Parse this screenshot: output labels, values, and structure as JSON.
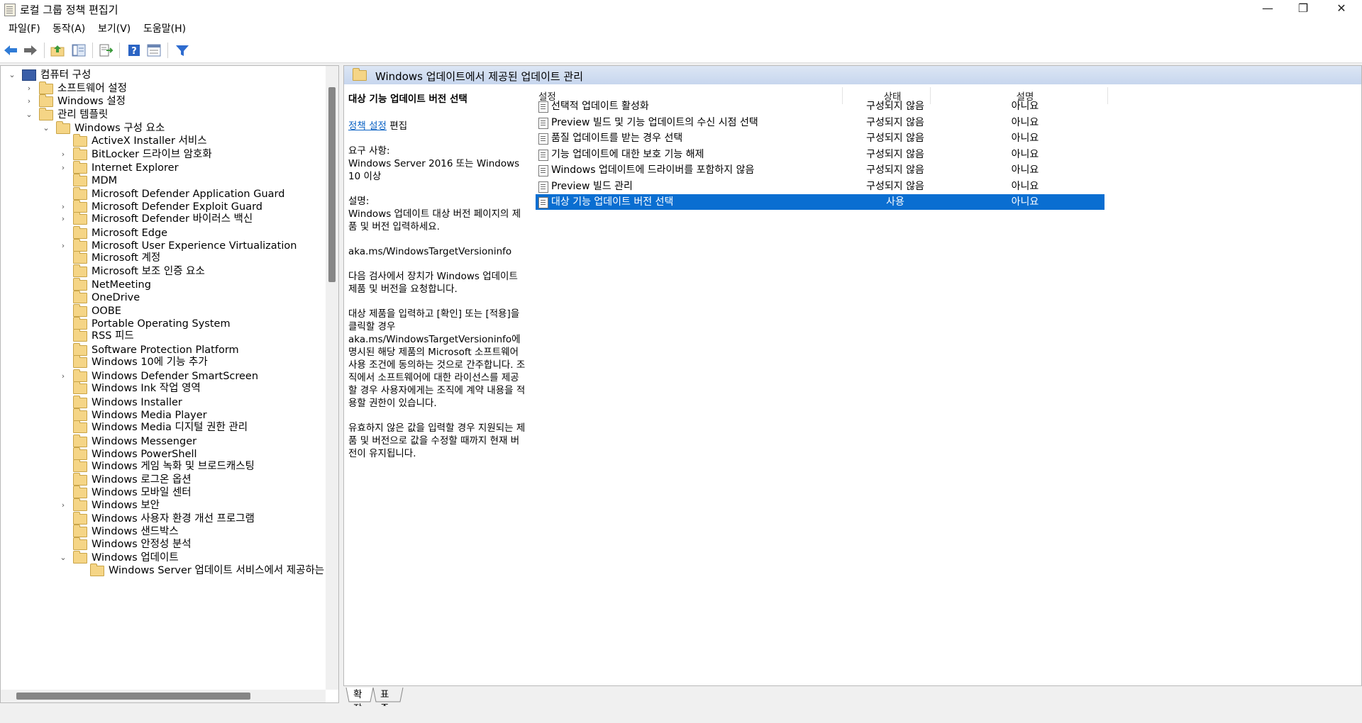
{
  "window": {
    "title": "로컬 그룹 정책 편집기",
    "minimize": "—",
    "restore": "❐",
    "close": "✕"
  },
  "menu": [
    "파일(F)",
    "동작(A)",
    "보기(V)",
    "도움말(H)"
  ],
  "toolbar": {
    "icons": [
      "back-arrow-icon",
      "forward-arrow-icon",
      "up-folder-icon",
      "show-hide-tree-icon",
      "export-list-icon",
      "help-icon",
      "properties-icon",
      "filter-icon"
    ],
    "colors": {
      "back": "#2f7bd6",
      "forward": "#6a6a6a",
      "help": "#2b64c4",
      "filter": "#2d6bcf"
    }
  },
  "tree": [
    {
      "label": "컴퓨터 구성",
      "exp": "⌄",
      "icon": "computer"
    },
    {
      "label": "소프트웨어 설정",
      "exp": "›"
    },
    {
      "label": "Windows 설정",
      "exp": "›"
    },
    {
      "label": "관리 템플릿",
      "exp": "⌄"
    },
    {
      "label": "Windows 구성 요소",
      "exp": "⌄"
    },
    {
      "label": "ActiveX Installer 서비스",
      "exp": ""
    },
    {
      "label": "BitLocker 드라이브 암호화",
      "exp": "›"
    },
    {
      "label": "Internet Explorer",
      "exp": "›"
    },
    {
      "label": "MDM",
      "exp": ""
    },
    {
      "label": "Microsoft Defender Application Guard",
      "exp": ""
    },
    {
      "label": "Microsoft Defender Exploit Guard",
      "exp": "›"
    },
    {
      "label": "Microsoft Defender 바이러스 백신",
      "exp": "›"
    },
    {
      "label": "Microsoft Edge",
      "exp": ""
    },
    {
      "label": "Microsoft User Experience Virtualization",
      "exp": "›"
    },
    {
      "label": "Microsoft 계정",
      "exp": ""
    },
    {
      "label": "Microsoft 보조 인증 요소",
      "exp": ""
    },
    {
      "label": "NetMeeting",
      "exp": ""
    },
    {
      "label": "OneDrive",
      "exp": ""
    },
    {
      "label": "OOBE",
      "exp": ""
    },
    {
      "label": "Portable Operating System",
      "exp": ""
    },
    {
      "label": "RSS 피드",
      "exp": ""
    },
    {
      "label": "Software Protection Platform",
      "exp": ""
    },
    {
      "label": "Windows 10에 기능 추가",
      "exp": ""
    },
    {
      "label": "Windows Defender SmartScreen",
      "exp": "›"
    },
    {
      "label": "Windows Ink 작업 영역",
      "exp": ""
    },
    {
      "label": "Windows Installer",
      "exp": ""
    },
    {
      "label": "Windows Media Player",
      "exp": ""
    },
    {
      "label": "Windows Media 디지털 권한 관리",
      "exp": ""
    },
    {
      "label": "Windows Messenger",
      "exp": ""
    },
    {
      "label": "Windows PowerShell",
      "exp": ""
    },
    {
      "label": "Windows 게임 녹화 및 브로드캐스팅",
      "exp": ""
    },
    {
      "label": "Windows 로그온 옵션",
      "exp": ""
    },
    {
      "label": "Windows 모바일 센터",
      "exp": ""
    },
    {
      "label": "Windows 보안",
      "exp": "›"
    },
    {
      "label": "Windows 사용자 환경 개선 프로그램",
      "exp": ""
    },
    {
      "label": "Windows 샌드박스",
      "exp": ""
    },
    {
      "label": "Windows 안정성 분석",
      "exp": ""
    },
    {
      "label": "Windows 업데이트",
      "exp": "⌄"
    },
    {
      "label": "Windows Server 업데이트 서비스에서 제공하는",
      "exp": ""
    }
  ],
  "header": {
    "title": "Windows 업데이트에서 제공된 업데이트 관리"
  },
  "description": {
    "heading": "대상 기능 업데이트 버전 선택",
    "edit_link": "정책 설정",
    "edit_suffix": " 편집",
    "requirements": "요구 사항:\nWindows Server 2016 또는 Windows 10 이상",
    "desc_label": "설명:\nWindows 업데이트 대상 버전 페이지의 제품 및 버전 입력하세요.",
    "link_text": "aka.ms/WindowsTargetVersioninfo",
    "para1": "다음 검사에서 장치가 Windows 업데이트 제품 및 버전을 요청합니다.",
    "para2": "대상 제품을 입력하고 [확인] 또는 [적용]을 클릭할 경우 aka.ms/WindowsTargetVersioninfo에 명시된 해당 제품의 Microsoft 소프트웨어 사용 조건에 동의하는 것으로 간주합니다. 조직에서 소프트웨어에 대한 라이선스를 제공할 경우 사용자에게는 조직에 계약 내용을 적용할 권한이 있습니다.",
    "para3": "유효하지 않은 값을 입력할 경우 지원되는 제품 및 버전으로 값을 수정할 때까지 현재 버전이 유지됩니다."
  },
  "columns": {
    "setting": "설정",
    "state": "상태",
    "comment": "설명"
  },
  "policies": [
    {
      "name": "선택적 업데이트 활성화",
      "state": "구성되지 않음",
      "comment": "아니요"
    },
    {
      "name": "Preview 빌드 및 기능 업데이트의 수신 시점 선택",
      "state": "구성되지 않음",
      "comment": "아니요"
    },
    {
      "name": "품질 업데이트를 받는 경우 선택",
      "state": "구성되지 않음",
      "comment": "아니요"
    },
    {
      "name": "기능 업데이트에 대한 보호 기능 해제",
      "state": "구성되지 않음",
      "comment": "아니요"
    },
    {
      "name": "Windows 업데이트에 드라이버를 포함하지 않음",
      "state": "구성되지 않음",
      "comment": "아니요"
    },
    {
      "name": "Preview 빌드 관리",
      "state": "구성되지 않음",
      "comment": "아니요"
    },
    {
      "name": "대상 기능 업데이트 버전 선택",
      "state": "사용",
      "comment": "아니요",
      "selected": true
    }
  ],
  "tabs": {
    "extended": "확장",
    "standard": "표준"
  },
  "colors": {
    "selection": "#0a6ed1",
    "link": "#0b62c4",
    "folder": "#f5d586"
  }
}
